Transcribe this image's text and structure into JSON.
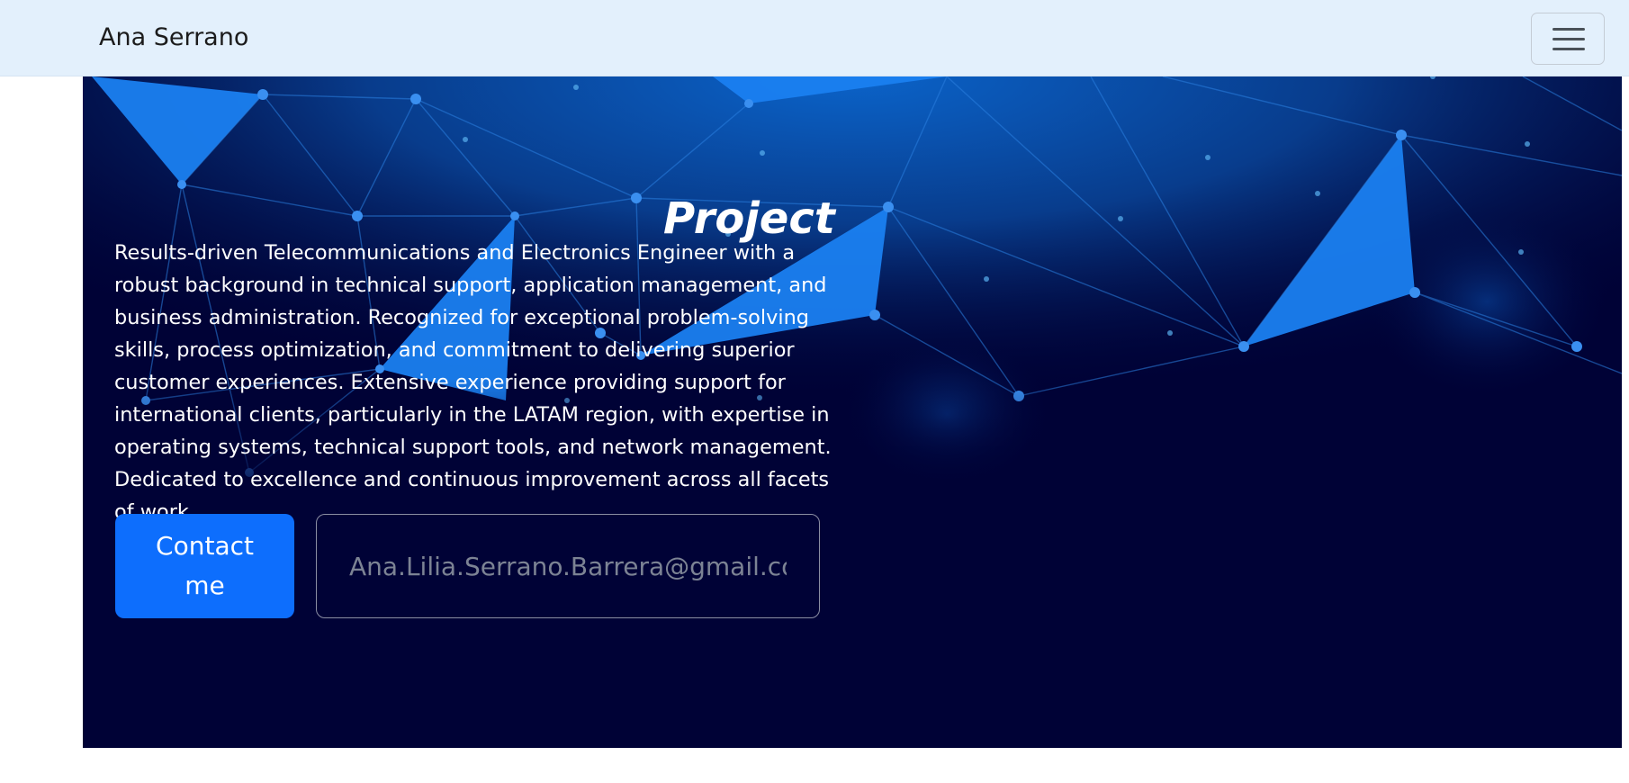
{
  "navbar": {
    "brand": "Ana Serrano",
    "toggler_icon": "hamburger-menu-icon"
  },
  "hero": {
    "title": "Project",
    "description": "Results-driven Telecommunications and Electronics Engineer with a robust background in technical support, application management, and business administration. Recognized for exceptional problem-solving skills, process optimization, and commitment to delivering superior customer experiences. Extensive experience providing support for international clients, particularly in the LATAM region, with expertise in operating systems, technical support tools, and network management. Dedicated to excellence and continuous improvement across all facets of work.",
    "contact_button": "Contact me",
    "email_placeholder": "Ana.Lilia.Serrano.Barrera@gmail.com"
  },
  "colors": {
    "navbar_bg": "#e3f0fc",
    "hero_bg": "#000236",
    "accent_blue": "#0d6efd",
    "network_blue": "#1a7ff0"
  }
}
